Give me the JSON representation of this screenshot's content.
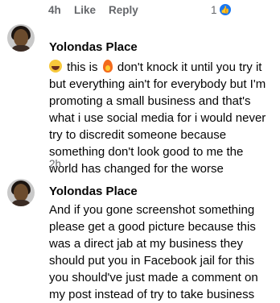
{
  "actions_bar": {
    "time": "4h",
    "like_label": "Like",
    "reply_label": "Reply",
    "reaction_count": "1"
  },
  "comments": [
    {
      "author": "Yolondas Place",
      "icons": [
        "laughing-emoji-icon",
        "fire-emoji-icon"
      ],
      "text_part1": "this is",
      "text_part2": "don't knock it until you try it but everything ain't for everybody but I'm promoting a small business and that's what i use social media for i would never try to discredit someone because something don't look good to me the world has changed for the worse",
      "time": "2h"
    },
    {
      "author": "Yolondas Place",
      "text": "And if you gone screenshot something please get a good picture because this was a direct jab at my business they should put you in Facebook jail for this you should've just made a comment on my post instead of try to take business"
    }
  ],
  "colors": {
    "secondary_text": "#65676b",
    "reaction_blue": "#1877f2"
  }
}
